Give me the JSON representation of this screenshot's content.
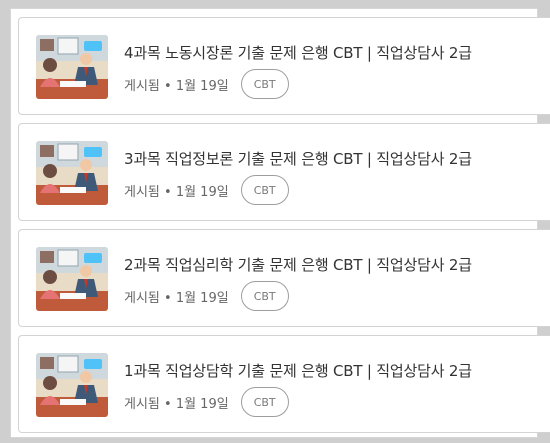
{
  "posts": [
    {
      "title": "4과목 노동시장론 기출 문제 은행 CBT | 직업상담사 2급",
      "date": "게시됨 • 1월 19일",
      "label": "CBT"
    },
    {
      "title": "3과목 직업정보론 기출 문제 은행 CBT | 직업상담사 2급",
      "date": "게시됨 • 1월 19일",
      "label": "CBT"
    },
    {
      "title": "2과목 직업심리학 기출 문제 은행 CBT | 직업상담사 2급",
      "date": "게시됨 • 1월 19일",
      "label": "CBT"
    },
    {
      "title": "1과목 직업상담학 기출 문제 은행 CBT | 직업상담사 2급",
      "date": "게시됨 • 1월 19일",
      "label": "CBT"
    }
  ]
}
